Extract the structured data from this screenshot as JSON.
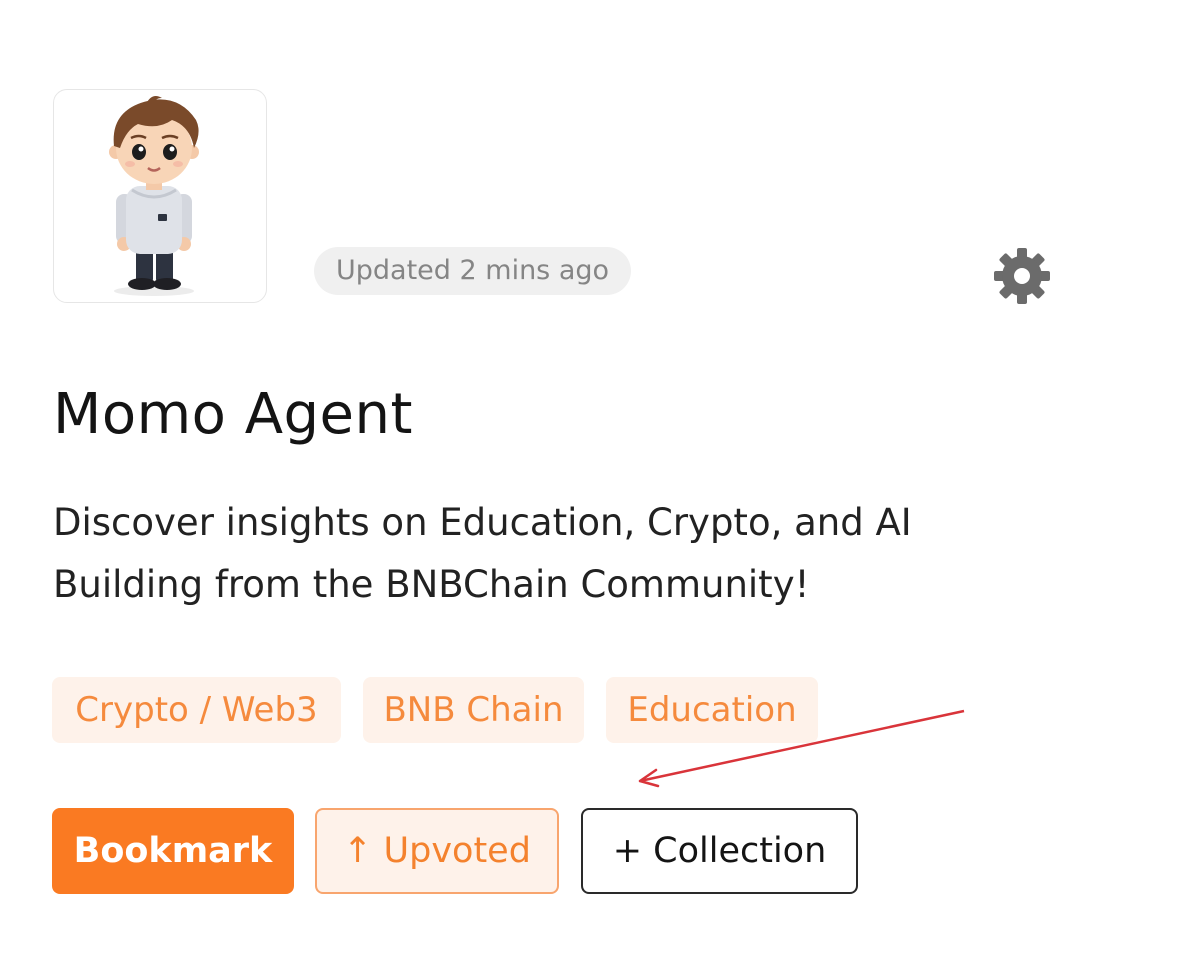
{
  "header": {
    "avatar_icon": "cartoon-boy-avatar",
    "updated_text": "Updated 2 mins ago",
    "settings_icon": "gear-icon"
  },
  "agent": {
    "title": "Momo Agent",
    "description": "Discover insights on Education, Crypto, and AI Building from the BNBChain Community!"
  },
  "tags": [
    "Crypto / Web3",
    "BNB Chain",
    "Education"
  ],
  "actions": {
    "bookmark_label": "Bookmark",
    "upvoted_label": "↑ Upvoted",
    "collection_label": "+ Collection"
  },
  "colors": {
    "accent_orange": "#fa7a22",
    "tag_bg": "#fef2ea",
    "tag_text": "#f58a3d",
    "annotation_arrow": "#d9343a"
  }
}
